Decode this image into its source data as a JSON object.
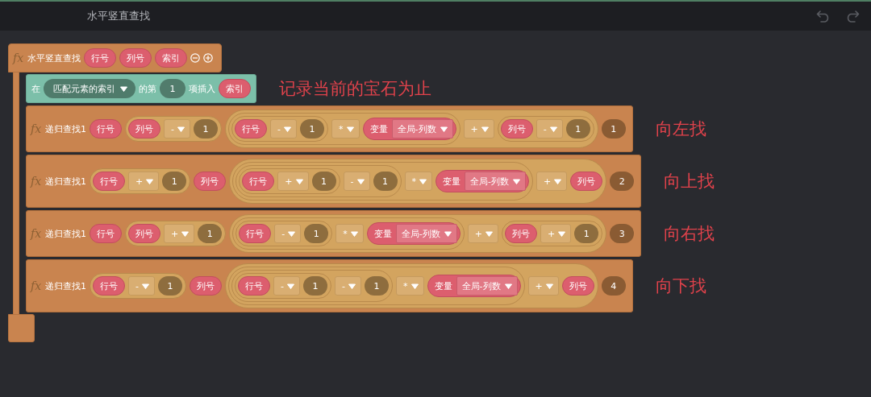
{
  "toolbar": {
    "title": "水平竖直查找"
  },
  "function": {
    "fx": "fx",
    "name": "水平竖直查找",
    "params": [
      "行号",
      "列号",
      "索引"
    ],
    "insert": {
      "items": [
        {
          "kind": "text",
          "text": "在"
        },
        {
          "kind": "list_dropdown",
          "text": "匹配元素的索引"
        },
        {
          "kind": "text",
          "text": "的第"
        },
        {
          "kind": "slot_num",
          "text": "1"
        },
        {
          "kind": "text",
          "text": "项插入"
        },
        {
          "kind": "var",
          "text": "索引"
        }
      ],
      "note": "记录当前的宝石为止"
    },
    "calls": [
      {
        "fx": "fx",
        "name": "递归查找1",
        "note": "向左找",
        "args": [
          {
            "kind": "var",
            "text": "行号"
          },
          {
            "kind": "group",
            "children": [
              {
                "kind": "var",
                "text": "列号"
              },
              {
                "kind": "op",
                "text": "-"
              },
              {
                "kind": "num",
                "text": "1"
              }
            ]
          },
          {
            "kind": "group",
            "children": [
              {
                "kind": "group",
                "children": [
                  {
                    "kind": "group",
                    "children": [
                      {
                        "kind": "var",
                        "text": "行号"
                      },
                      {
                        "kind": "op",
                        "text": "-"
                      },
                      {
                        "kind": "num",
                        "text": "1"
                      }
                    ]
                  },
                  {
                    "kind": "op",
                    "text": "*"
                  },
                  {
                    "kind": "global_var",
                    "label": "变量",
                    "text": "全局-列数"
                  }
                ]
              },
              {
                "kind": "op",
                "text": "+"
              },
              {
                "kind": "group",
                "children": [
                  {
                    "kind": "var",
                    "text": "列号"
                  },
                  {
                    "kind": "op",
                    "text": "-"
                  },
                  {
                    "kind": "num",
                    "text": "1"
                  }
                ]
              }
            ]
          },
          {
            "kind": "index",
            "text": "1"
          }
        ]
      },
      {
        "fx": "fx",
        "name": "递归查找1",
        "note": "向上找",
        "args": [
          {
            "kind": "group",
            "children": [
              {
                "kind": "var",
                "text": "行号"
              },
              {
                "kind": "op",
                "text": "+"
              },
              {
                "kind": "num",
                "text": "1"
              }
            ]
          },
          {
            "kind": "var",
            "text": "列号"
          },
          {
            "kind": "group",
            "children": [
              {
                "kind": "group",
                "children": [
                  {
                    "kind": "group",
                    "children": [
                      {
                        "kind": "group",
                        "children": [
                          {
                            "kind": "var",
                            "text": "行号"
                          },
                          {
                            "kind": "op",
                            "text": "+"
                          },
                          {
                            "kind": "num",
                            "text": "1"
                          }
                        ]
                      },
                      {
                        "kind": "op",
                        "text": "-"
                      },
                      {
                        "kind": "num",
                        "text": "1"
                      }
                    ]
                  },
                  {
                    "kind": "op",
                    "text": "*"
                  },
                  {
                    "kind": "global_var",
                    "label": "变量",
                    "text": "全局-列数"
                  }
                ]
              },
              {
                "kind": "op",
                "text": "+"
              },
              {
                "kind": "var",
                "text": "列号"
              }
            ]
          },
          {
            "kind": "index",
            "text": "2"
          }
        ]
      },
      {
        "fx": "fx",
        "name": "递归查找1",
        "note": "向右找",
        "args": [
          {
            "kind": "var",
            "text": "行号"
          },
          {
            "kind": "group",
            "children": [
              {
                "kind": "var",
                "text": "列号"
              },
              {
                "kind": "op",
                "text": "+"
              },
              {
                "kind": "num",
                "text": "1"
              }
            ]
          },
          {
            "kind": "group",
            "children": [
              {
                "kind": "group",
                "children": [
                  {
                    "kind": "group",
                    "children": [
                      {
                        "kind": "var",
                        "text": "行号"
                      },
                      {
                        "kind": "op",
                        "text": "-"
                      },
                      {
                        "kind": "num",
                        "text": "1"
                      }
                    ]
                  },
                  {
                    "kind": "op",
                    "text": "*"
                  },
                  {
                    "kind": "global_var",
                    "label": "变量",
                    "text": "全局-列数"
                  }
                ]
              },
              {
                "kind": "op",
                "text": "+"
              },
              {
                "kind": "group",
                "children": [
                  {
                    "kind": "var",
                    "text": "列号"
                  },
                  {
                    "kind": "op",
                    "text": "+"
                  },
                  {
                    "kind": "num",
                    "text": "1"
                  }
                ]
              }
            ]
          },
          {
            "kind": "index",
            "text": "3"
          }
        ]
      },
      {
        "fx": "fx",
        "name": "递归查找1",
        "note": "向下找",
        "args": [
          {
            "kind": "group",
            "children": [
              {
                "kind": "var",
                "text": "行号"
              },
              {
                "kind": "op",
                "text": "-"
              },
              {
                "kind": "num",
                "text": "1"
              }
            ]
          },
          {
            "kind": "var",
            "text": "列号"
          },
          {
            "kind": "group",
            "children": [
              {
                "kind": "group",
                "children": [
                  {
                    "kind": "group",
                    "children": [
                      {
                        "kind": "group",
                        "children": [
                          {
                            "kind": "var",
                            "text": "行号"
                          },
                          {
                            "kind": "op",
                            "text": "-"
                          },
                          {
                            "kind": "num",
                            "text": "1"
                          }
                        ]
                      },
                      {
                        "kind": "op",
                        "text": "-"
                      },
                      {
                        "kind": "num",
                        "text": "1"
                      }
                    ]
                  },
                  {
                    "kind": "op",
                    "text": "*"
                  },
                  {
                    "kind": "global_var",
                    "label": "变量",
                    "text": "全局-列数"
                  }
                ]
              },
              {
                "kind": "op",
                "text": "+"
              },
              {
                "kind": "var",
                "text": "列号"
              }
            ]
          },
          {
            "kind": "index",
            "text": "4"
          }
        ]
      }
    ]
  }
}
